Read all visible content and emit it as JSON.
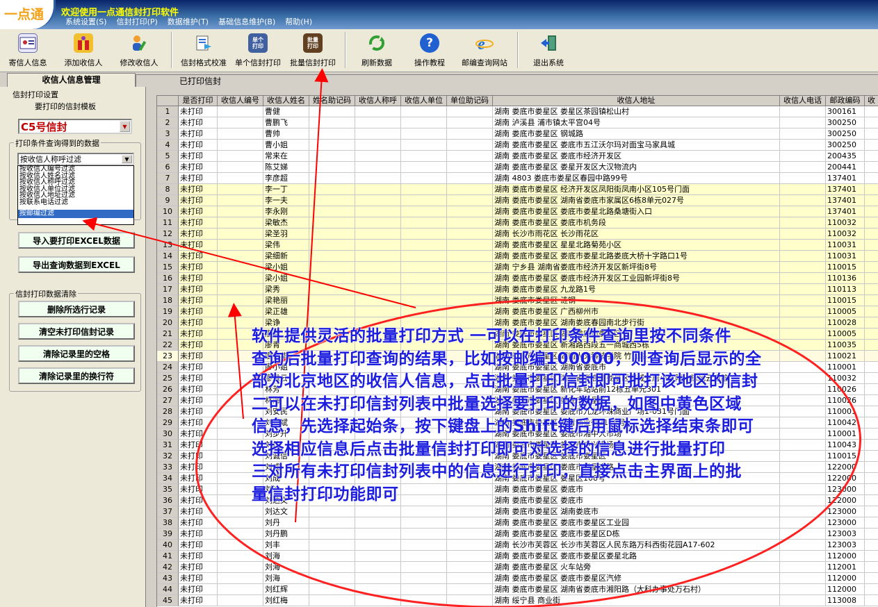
{
  "app": {
    "logo": "一点通",
    "title": "欢迎使用一点通信封打印软件"
  },
  "menu": [
    "系统设置(S)",
    "信封打印(P)",
    "数据维护(T)",
    "基础信息维护(B)",
    "帮助(H)"
  ],
  "toolbar": [
    {
      "label": "寄信人信息",
      "icon": "sender-card-icon"
    },
    {
      "label": "添加收信人",
      "icon": "add-recipient-icon"
    },
    {
      "label": "修改收信人",
      "icon": "edit-recipient-icon"
    },
    {
      "label": "信封格式校准",
      "icon": "format-calibrate-icon"
    },
    {
      "label": "单个信封打印",
      "icon": "single-print-icon",
      "icon_text": "单个\n打印"
    },
    {
      "label": "批量信封打印",
      "icon": "batch-print-icon",
      "icon_text": "批量\n打印"
    },
    {
      "label": "刷新数据",
      "icon": "refresh-icon"
    },
    {
      "label": "操作教程",
      "icon": "help-icon"
    },
    {
      "label": "邮编查询网站",
      "icon": "ie-browser-icon"
    },
    {
      "label": "退出系统",
      "icon": "exit-icon"
    }
  ],
  "tabs": {
    "left": "收信人信息管理",
    "right": "已打印信封"
  },
  "left_panel": {
    "print_settings_label": "信封打印设置",
    "template_label": "要打印的信封模板",
    "template_value": "C5号信封",
    "filter_group_label": "打印条件查询得到的数据",
    "filter_value": "按收信人称呼过滤",
    "filter_options": [
      "按收信人编号过滤",
      "按收信人姓名过滤",
      "按收信人称呼过滤",
      "按收信人单位过滤",
      "按收信人地址过滤",
      "按联系电话过滤",
      "按邮编过滤"
    ],
    "import_button": "导入要打印EXCEL数据",
    "export_button": "导出查询数据到EXCEL",
    "clear_group_label": "信封打印数据清除",
    "delete_selected_button": "删除所选行记录",
    "clear_unprinted_button": "清空未打印信封记录",
    "clear_spaces_button": "清除记录里的空格",
    "clear_newlines_button": "清除记录里的换行符"
  },
  "grid": {
    "columns": [
      "是否打印",
      "收信人编号",
      "收信人姓名",
      "姓名助记码",
      "收信人称呼",
      "收信人单位",
      "单位助记码",
      "收信人地址",
      "收信人电话",
      "邮政编码",
      "收"
    ],
    "rows": [
      {
        "n": "1",
        "status": "未打印",
        "name": "曹健",
        "addr": "湖南 娄底市娄星区 娄星区茶园镇松山村",
        "zip": "300161"
      },
      {
        "n": "2",
        "status": "未打印",
        "name": "曹鹏飞",
        "addr": "湖南 泸溪县 浦市镇太平宫04号",
        "zip": "300250"
      },
      {
        "n": "3",
        "status": "未打印",
        "name": "曹帅",
        "addr": "湖南 娄底市娄星区 钢城路",
        "zip": "300250"
      },
      {
        "n": "4",
        "status": "未打印",
        "name": "曹小姐",
        "addr": "湖南 娄底市娄星区 娄底市五江沃尔玛对面宝马家具城",
        "zip": "300250"
      },
      {
        "n": "5",
        "status": "未打印",
        "name": "常来在",
        "addr": "湖南 娄底市娄星区 娄底市经济开发区",
        "zip": "200435"
      },
      {
        "n": "6",
        "status": "未打印",
        "name": "陈艾娣",
        "addr": "湖南 娄底市娄星区 娄星开发区大汉物流内",
        "zip": "200441"
      },
      {
        "n": "7",
        "status": "未打印",
        "name": "李彦超",
        "addr": "湖南 4803 娄底市娄星区春园中路99号",
        "zip": "137401"
      },
      {
        "n": "8",
        "status": "未打印",
        "name": "李一丁",
        "addr": "湖南 娄底市娄星区 经济开发区凤阳街凤南小区105号门面",
        "zip": "137401",
        "hl": true
      },
      {
        "n": "9",
        "status": "未打印",
        "name": "李一夫",
        "addr": "湖南 娄底市娄星区 湖南省娄底市家属区6栋8单元027号",
        "zip": "137401",
        "hl": true
      },
      {
        "n": "10",
        "status": "未打印",
        "name": "李永刚",
        "addr": "湖南 娄底市娄星区 娄底市娄星北路桑塘街入口",
        "zip": "137401",
        "hl": true
      },
      {
        "n": "11",
        "status": "未打印",
        "name": "梁敏杰",
        "addr": "湖南 娄底市娄星区 娄底市机务段",
        "zip": "110032",
        "hl": true
      },
      {
        "n": "12",
        "status": "未打印",
        "name": "梁圣羽",
        "addr": "湖南 长沙市雨花区 长沙雨花区",
        "zip": "110032",
        "hl": true
      },
      {
        "n": "13",
        "status": "未打印",
        "name": "梁伟",
        "addr": "湖南 娄底市娄星区 星星北路菊苑小区",
        "zip": "110031",
        "hl": true
      },
      {
        "n": "14",
        "status": "未打印",
        "name": "梁细新",
        "addr": "湖南 娄底市娄星区 娄底市娄星北路娄底大桥十字路口1号",
        "zip": "110031",
        "hl": true
      },
      {
        "n": "15",
        "status": "未打印",
        "name": "梁小姐",
        "addr": "湖南 宁乡县 湖南省娄底市经济开发区新坪街8号",
        "zip": "110015",
        "hl": true
      },
      {
        "n": "16",
        "status": "未打印",
        "name": "梁小姐",
        "addr": "湖南 娄底市娄星区 娄底市经济开发区工业园新坪街8号",
        "zip": "110136",
        "hl": true
      },
      {
        "n": "17",
        "status": "未打印",
        "name": "梁秀",
        "addr": "湖南 娄底市娄星区 九龙路1号",
        "zip": "110113",
        "hl": true
      },
      {
        "n": "18",
        "status": "未打印",
        "name": "梁艳丽",
        "addr": "湖南 娄底市娄星区 涟钢",
        "zip": "110015",
        "hl": true
      },
      {
        "n": "19",
        "status": "未打印",
        "name": "梁正雄",
        "addr": "湖南 娄底市娄星区 广西柳州市",
        "zip": "110005",
        "hl": true
      },
      {
        "n": "20",
        "status": "未打印",
        "name": "梁诤",
        "addr": "湖南 娄底市娄星区 湖南娄底春园南北步行街",
        "zip": "110028",
        "hl": true
      },
      {
        "n": "21",
        "status": "未打印",
        "name": "廖浩",
        "addr": "湖南 娄底市娄星区 湖南娄底市娄星区",
        "zip": "110005",
        "hl": true
      },
      {
        "n": "22",
        "status": "未打印",
        "name": "廖青",
        "addr": "湖南 娄底市娄星区 新湘路西段五一商城西5栋",
        "zip": "110035",
        "hl": true
      },
      {
        "n": "23",
        "status": "未打印",
        "name": "廖伟华",
        "addr": "湖南 娄底市娄星区 湖南人文科技学院 竹山路",
        "zip": "110021",
        "hl": true,
        "cur": true
      },
      {
        "n": "24",
        "status": "未打印",
        "name": "廖小姐",
        "addr": "湖南 娄底市娄星区 湖南省娄底市",
        "zip": "110001"
      },
      {
        "n": "25",
        "status": "未打印",
        "name": "廖雅云",
        "addr": "湖南 娄底市娄星区 湖南省娄底市娄星区钢城安居小区附一栋风云电脑",
        "zip": "110032"
      },
      {
        "n": "26",
        "status": "未打印",
        "name": "林芳",
        "addr": "湖南 娄底市娄星区 新化车站站前12栋五单元301",
        "zip": "110026"
      },
      {
        "n": "27",
        "status": "未打印",
        "name": "林海",
        "addr": "湖南 娄底市娄星区 娄底市娄星区",
        "zip": "110026"
      },
      {
        "n": "28",
        "status": "未打印",
        "name": "刘安民",
        "addr": "湖南 娄底市娄星区 娄底市九龙环珠商业广场1-031号门面",
        "zip": "110001"
      },
      {
        "n": "29",
        "status": "未打印",
        "name": "刘斌斌",
        "addr": "湖南 娄底市娄星区 长青商业街2168号",
        "zip": "110042"
      },
      {
        "n": "30",
        "status": "未打印",
        "name": "刘步升",
        "addr": "湖南 娄底市娄星区 娄底市湘中大市场",
        "zip": "110001"
      },
      {
        "n": "31",
        "status": "未打印",
        "name": "刘灿",
        "addr": "湖南 娄底市娄星区 娄底市中兴市场",
        "zip": "110043"
      },
      {
        "n": "32",
        "status": "未打印",
        "name": "刘诚信",
        "addr": "湖南 娄底市娄星区 娄底市娄星区",
        "zip": "110015"
      },
      {
        "n": "33",
        "status": "未打印",
        "name": "刘成",
        "addr": "湖南 娄底市娄星区 娄底市娄星南路",
        "zip": "122000"
      },
      {
        "n": "34",
        "status": "未打印",
        "name": "刘成",
        "addr": "湖南 娄底市娄星区 娄星区108号",
        "zip": "122000"
      },
      {
        "n": "35",
        "status": "未打印",
        "name": "刘达",
        "addr": "湖南 娄底市娄星区 娄底市",
        "zip": "123000"
      },
      {
        "n": "36",
        "status": "未打印",
        "name": "刘达文",
        "addr": "湖南 娄底市娄星区 娄底市",
        "zip": "122000"
      },
      {
        "n": "37",
        "status": "未打印",
        "name": "刘达文",
        "addr": "湖南 娄底市娄星区 湖南娄底市",
        "zip": "123000"
      },
      {
        "n": "38",
        "status": "未打印",
        "name": "刘丹",
        "addr": "湖南 娄底市娄星区 娄底市娄星区工业园",
        "zip": "123000"
      },
      {
        "n": "39",
        "status": "未打印",
        "name": "刘丹鹏",
        "addr": "湖南 娄底市娄星区 娄底市娄星区D栋",
        "zip": "123003"
      },
      {
        "n": "40",
        "status": "未打印",
        "name": "刘丰",
        "addr": "湖南 长沙市芙蓉区 长沙市芙蓉区人民东路万科西街花园A17-602",
        "zip": "123003"
      },
      {
        "n": "41",
        "status": "未打印",
        "name": "刘海",
        "addr": "湖南 娄底市娄星区 娄底市娄星区娄星北路",
        "zip": "112000"
      },
      {
        "n": "42",
        "status": "未打印",
        "name": "刘海",
        "addr": "湖南 娄底市娄星区 火车站旁",
        "zip": "112001"
      },
      {
        "n": "43",
        "status": "未打印",
        "name": "刘海",
        "addr": "湖南 娄底市娄星区 娄底市娄星区汽修",
        "zip": "112000"
      },
      {
        "n": "44",
        "status": "未打印",
        "name": "刘红辉",
        "addr": "湖南 娄底市娄星区 湖南省娄底市湘阳路（大科办事处万石村）",
        "zip": "112000"
      },
      {
        "n": "45",
        "status": "未打印",
        "name": "刘红梅",
        "addr": "湖南 绥宁县 商业街",
        "zip": "113008"
      }
    ]
  },
  "annotation": {
    "lines": [
      "软件提供灵活的批量打印方式 一可以在打印条件查询里按不同条件",
      "查询后批量打印查询的结果，比如按邮编100000，则查询后显示的全",
      "部为北京地区的收信人信息，点击批量打印信封即可批打该地区的信封",
      "二可以在未打印信封列表中批量选择要打印的数据，如图中黄色区域",
      "信息，先选择起始条，按下键盘上的Shift键后用鼠标选择结束条即可",
      "选择相应信息后点击批量信封打印即可对选择的信息进行批量打印",
      "三对所有未打印信封列表中的信息进行打印，直接点击主界面上的批",
      "量信封打印功能即可"
    ],
    "color": "#1d1ddf",
    "arrow_color": "#ff0000"
  }
}
